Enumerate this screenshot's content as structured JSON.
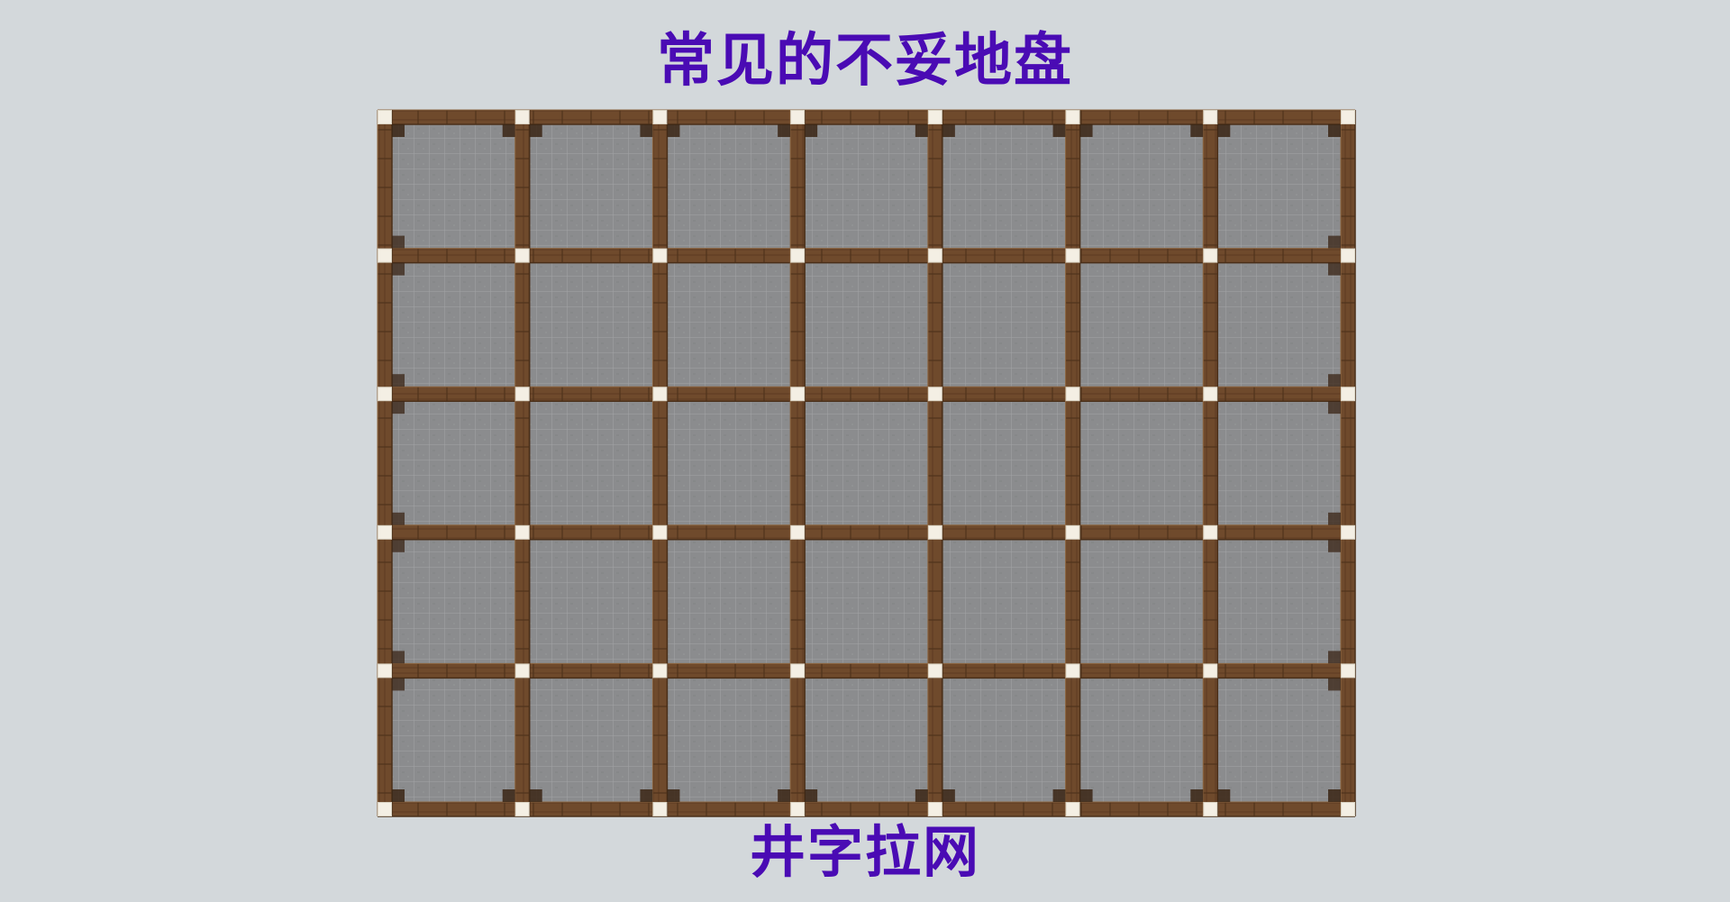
{
  "title": "常见的不妥地盘",
  "caption": "井字拉网",
  "colors": {
    "background": "#d3d8db",
    "text": "#4a0bb4",
    "beam": "#6f4a2c",
    "beam_dark": "#4a2f19",
    "beam_light": "#8d6641",
    "node": "#f4efe4",
    "stone": "#8b8c8e",
    "stone_line": "#a3a4a6",
    "corner_bracket": "#3a2414"
  },
  "grid": {
    "columns": 7,
    "rows": 5
  }
}
